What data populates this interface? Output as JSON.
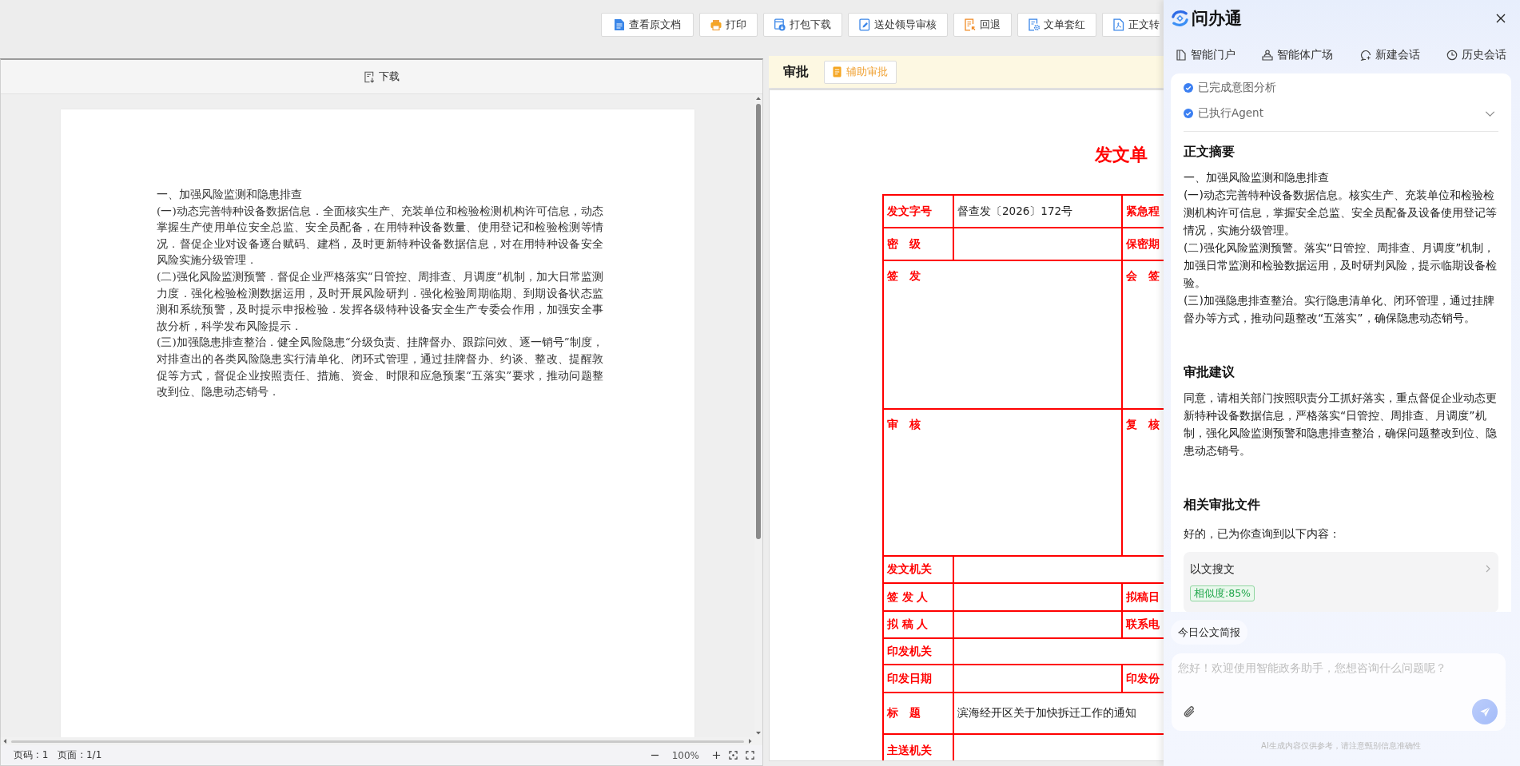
{
  "toolbar": {
    "buttons": [
      {
        "label": "查看原文档",
        "kind": "view"
      },
      {
        "label": "打印",
        "kind": "print"
      },
      {
        "label": "打包下载",
        "kind": "download"
      },
      {
        "label": "送处领导审核",
        "kind": "submit"
      },
      {
        "label": "回退",
        "kind": "return"
      },
      {
        "label": "文单套红",
        "kind": "redline"
      },
      {
        "label": "正文转",
        "kind": "convert"
      }
    ]
  },
  "viewer": {
    "download_label": "下载",
    "document": {
      "heading": "一、加强风险监测和隐患排查",
      "paragraphs": [
        "(一)动态完善特种设备数据信息．全面核实生产、充装单位和检验检测机构许可信息，动态掌握生产使用单位安全总监、安全员配备，在用特种设备数量、使用登记和检验检测等情况．督促企业对设备逐台赋码、建档，及时更新特种设备数据信息，对在用特种设备安全风险实施分级管理．",
        "(二)强化风险监测预警．督促企业严格落实“日管控、周排查、月调度”机制，加大日常监测力度．强化检验检测数据运用，及时开展风险研判．强化检验周期临期、到期设备状态监测和系统预警，及时提示申报检验．发挥各级特种设备安全生产专委会作用，加强安全事故分析，科学发布风险提示．",
        "(三)加强隐患排查整治．健全风险隐患“分级负责、挂牌督办、跟踪问效、逐一销号”制度，对排查出的各类风险隐患实行清单化、闭环式管理，通过挂牌督办、约谈、整改、提醒敦促等方式，督促企业按照责任、措施、资金、时限和应急预案“五落实”要求，推动问题整改到位、隐患动态销号．"
      ]
    },
    "status": {
      "page_number": "页码 : 1",
      "page_count": "页面 : 1/1",
      "zoom": "100%"
    }
  },
  "approval": {
    "title": "审批",
    "assist_button": "辅助审批",
    "form": {
      "title": "发文单",
      "rows": [
        {
          "kind": "pair",
          "label": "发文字号",
          "value": "督查发〔2026〕172号",
          "label2": "紧急程"
        },
        {
          "kind": "pair",
          "label": "密　级",
          "label2": "保密期"
        },
        {
          "kind": "tall",
          "label": "签　发",
          "label2": "会　签"
        },
        {
          "kind": "tall",
          "label": "审　核",
          "label2": "复　核"
        },
        {
          "kind": "wide",
          "label": "发文机关"
        },
        {
          "kind": "pair",
          "label": "签 发 人",
          "label2": "拟稿日"
        },
        {
          "kind": "pair",
          "label": "拟 稿 人",
          "label2": "联系电"
        },
        {
          "kind": "wide",
          "label": "印发机关"
        },
        {
          "kind": "pair",
          "label": "印发日期",
          "label2": "印发份"
        },
        {
          "kind": "wide",
          "label": "标　题",
          "value": "滨海经开区关于加快拆迁工作的通知"
        },
        {
          "kind": "wide",
          "label": "主送机关"
        }
      ]
    }
  },
  "assistant": {
    "title": "问办通",
    "nav": [
      {
        "label": "智能门户",
        "kind": "portal"
      },
      {
        "label": "智能体广场",
        "kind": "agents"
      },
      {
        "label": "新建会话",
        "kind": "chat"
      },
      {
        "label": "历史会话",
        "kind": "history"
      }
    ],
    "steps": {
      "expanded": false,
      "items": [
        {
          "label": "已完成意图分析",
          "done": true
        },
        {
          "label": "已执行Agent",
          "done": true
        }
      ]
    },
    "sections": [
      {
        "kind": "text",
        "title": "正文摘要",
        "paragraphs": [
          "一、加强风险监测和隐患排查",
          "(一)动态完善特种设备数据信息。核实生产、充装单位和检验检测机构许可信息，掌握安全总监、安全员配备及设备使用登记等情况，实施分级管理。",
          "(二)强化风险监测预警。落实“日管控、周排查、月调度”机制，加强日常监测和检验数据运用，及时研判风险，提示临期设备检验。",
          "(三)加强隐患排查整治。实行隐患清单化、闭环管理，通过挂牌督办等方式，推动问题整改“五落实”，确保隐患动态销号。"
        ]
      },
      {
        "kind": "text",
        "title": "审批建议",
        "paragraphs": [
          "同意，请相关部门按照职责分工抓好落实，重点督促企业动态更新特种设备数据信息，严格落实“日管控、周排查、月调度”机制，强化风险监测预警和隐患排查整治，确保问题整改到位、隐患动态销号。"
        ]
      },
      {
        "kind": "results",
        "title": "相关审批文件",
        "intro": "好的，已为你查询到以下内容：",
        "results": [
          {
            "title": "以文搜文",
            "badge": "相似度:85%"
          }
        ]
      }
    ],
    "quick_actions": [
      "今日公文简报"
    ],
    "input": {
      "placeholder": "您好！欢迎使用智能政务助手，您想咨询什么问题呢？",
      "send_disabled": true
    },
    "disclaimer": "AI生成内容仅供参考，请注意甄别信息准确性"
  }
}
